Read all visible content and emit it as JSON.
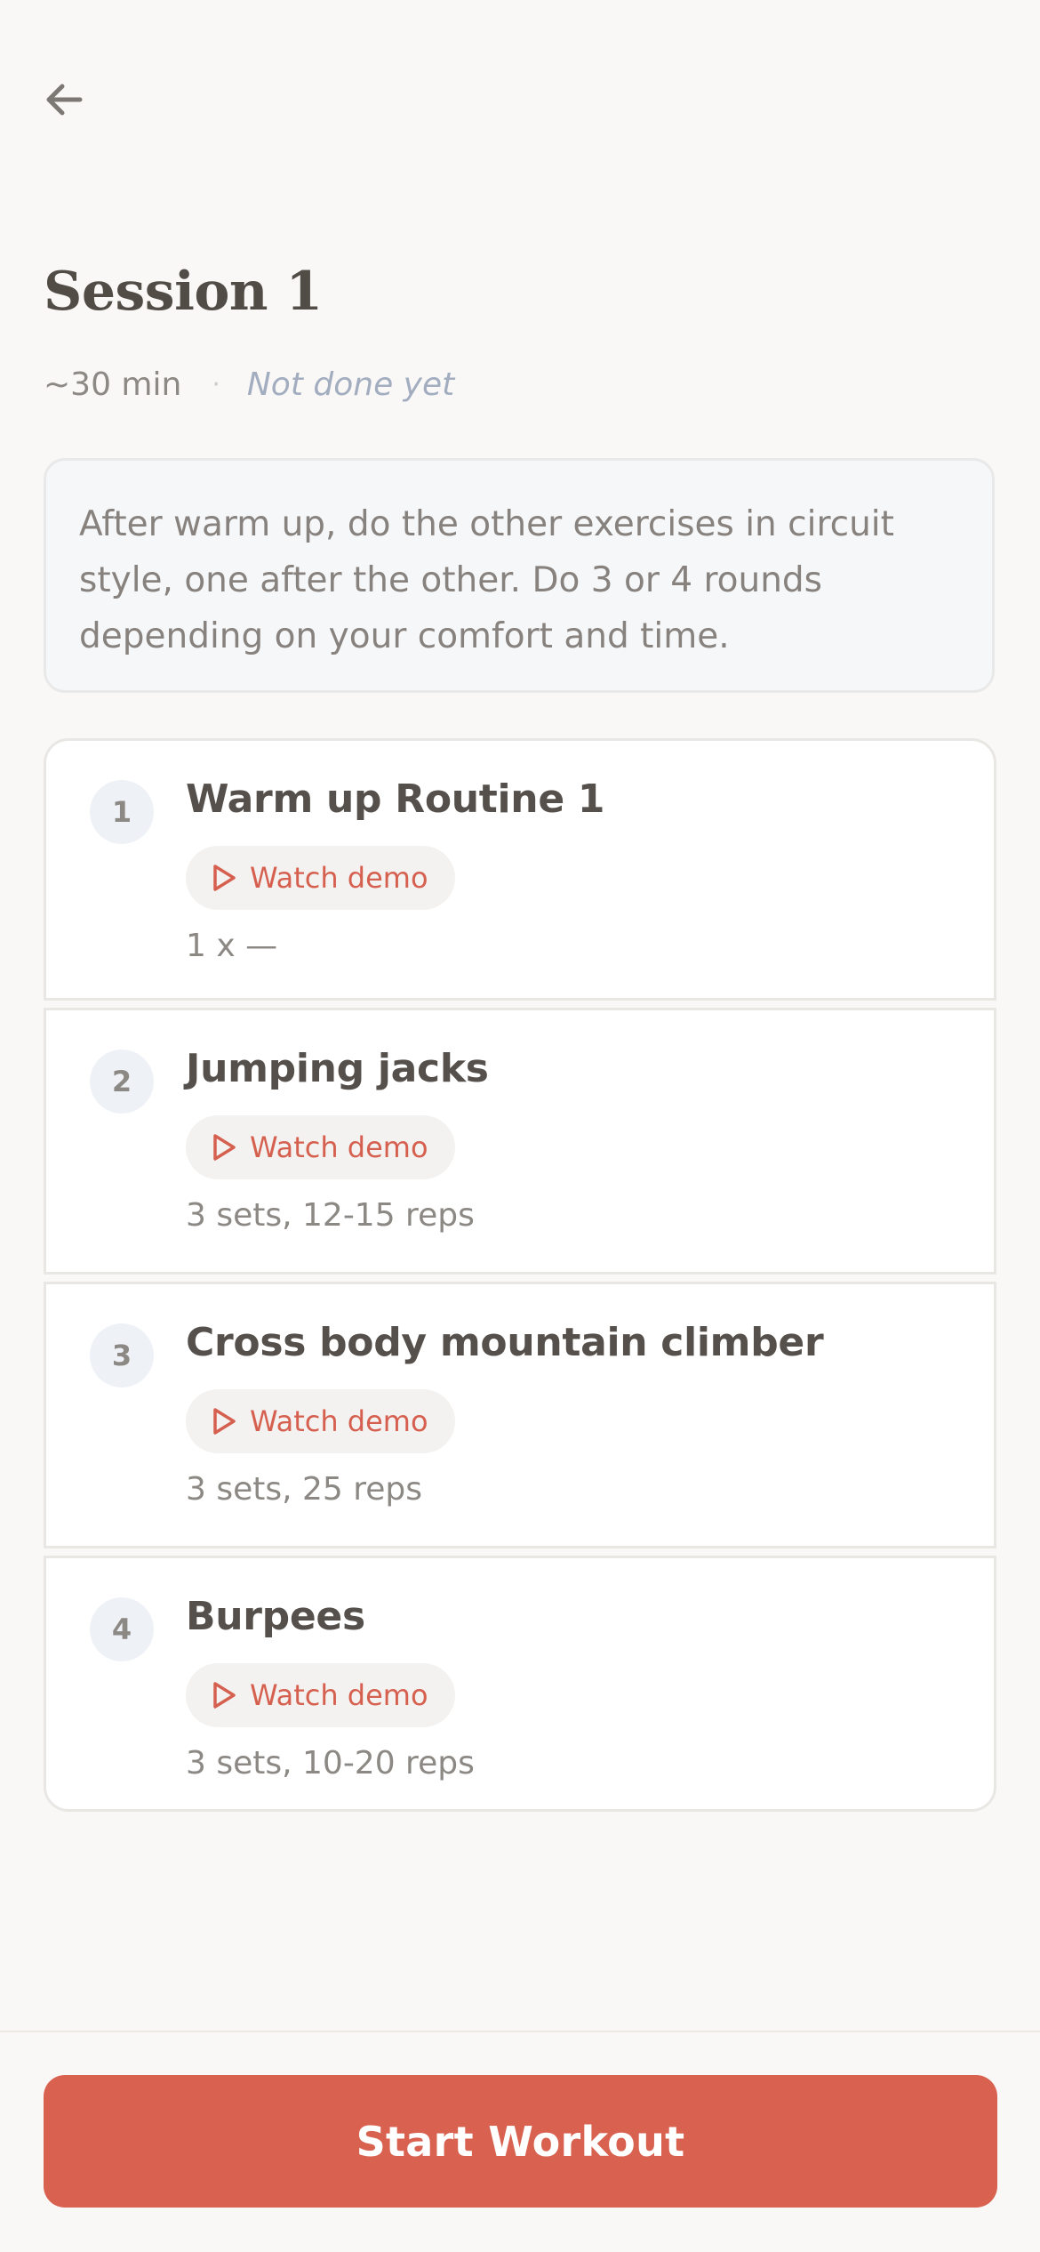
{
  "header": {
    "back_icon": "arrow-left-icon"
  },
  "session": {
    "title": "Session 1",
    "duration": "~30 min",
    "separator": "·",
    "status": "Not done yet",
    "note": "After warm up, do the other exercises in circuit style, one after the other. Do 3 or 4 rounds depending on your comfort and time."
  },
  "exercises": [
    {
      "number": "1",
      "name": "Warm up Routine 1",
      "demo_label": "Watch demo",
      "reps": "1 x —"
    },
    {
      "number": "2",
      "name": "Jumping jacks",
      "demo_label": "Watch demo",
      "reps": "3 sets, 12-15 reps"
    },
    {
      "number": "3",
      "name": "Cross body mountain climber",
      "demo_label": "Watch demo",
      "reps": "3 sets, 25 reps"
    },
    {
      "number": "4",
      "name": "Burpees",
      "demo_label": "Watch demo",
      "reps": "3 sets, 10-20 reps"
    }
  ],
  "footer": {
    "start_label": "Start Workout"
  },
  "colors": {
    "accent": "#d8614f",
    "background": "#f9f8f6",
    "status": "#a3adc0"
  }
}
